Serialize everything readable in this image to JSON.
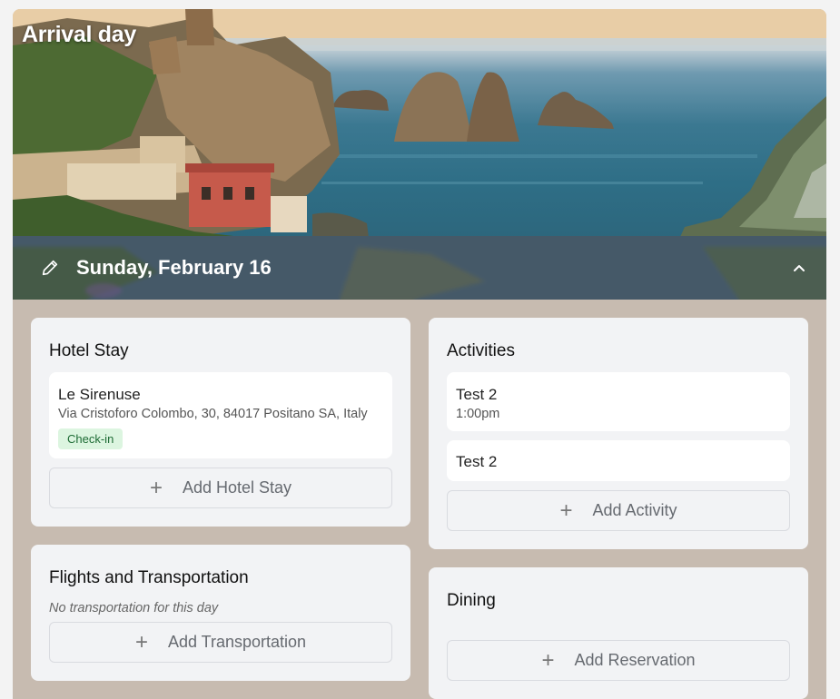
{
  "day": {
    "title": "Arrival day",
    "date": "Sunday, February 16"
  },
  "hotel": {
    "title": "Hotel Stay",
    "items": [
      {
        "name": "Le Sirenuse",
        "address": "Via Cristoforo Colombo, 30, 84017 Positano SA, Italy",
        "badge": "Check-in"
      }
    ],
    "add_label": "Add Hotel Stay"
  },
  "activities": {
    "title": "Activities",
    "items": [
      {
        "name": "Test 2",
        "time": "1:00pm"
      },
      {
        "name": "Test 2"
      }
    ],
    "add_label": "Add Activity"
  },
  "transport": {
    "title": "Flights and Transportation",
    "empty": "No transportation for this day",
    "add_label": "Add Transportation"
  },
  "dining": {
    "title": "Dining",
    "add_label": "Add Reservation"
  },
  "icons": {
    "edit": "pencil-icon",
    "collapse": "chevron-up-icon",
    "add": "plus-icon"
  }
}
